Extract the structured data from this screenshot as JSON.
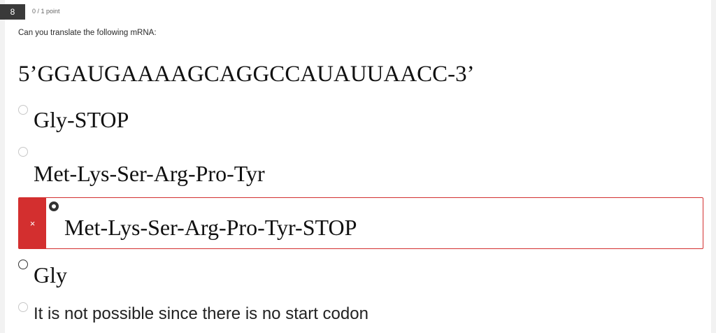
{
  "question": {
    "number": "8",
    "points": "0 / 1 point",
    "prompt": "Can you translate the following mRNA:",
    "sequence": "5’GGAUGAAAAGCAGGCCAUAUUAACC-3’"
  },
  "options": [
    {
      "label": "Gly-STOP",
      "selected": false
    },
    {
      "label": "Met-Lys-Ser-Arg-Pro-Tyr",
      "selected": false
    },
    {
      "label": "Met-Lys-Ser-Arg-Pro-Tyr-STOP",
      "selected": true,
      "result": "incorrect"
    },
    {
      "label": "Gly",
      "selected": false
    },
    {
      "label": "It is not possible since there is no start codon",
      "selected": false
    }
  ],
  "feedback": {
    "incorrect_icon_glyph": "×",
    "incorrect_icon": "close-icon"
  },
  "colors": {
    "incorrect": "#d32f2f",
    "question_badge": "#3a3a3a"
  }
}
